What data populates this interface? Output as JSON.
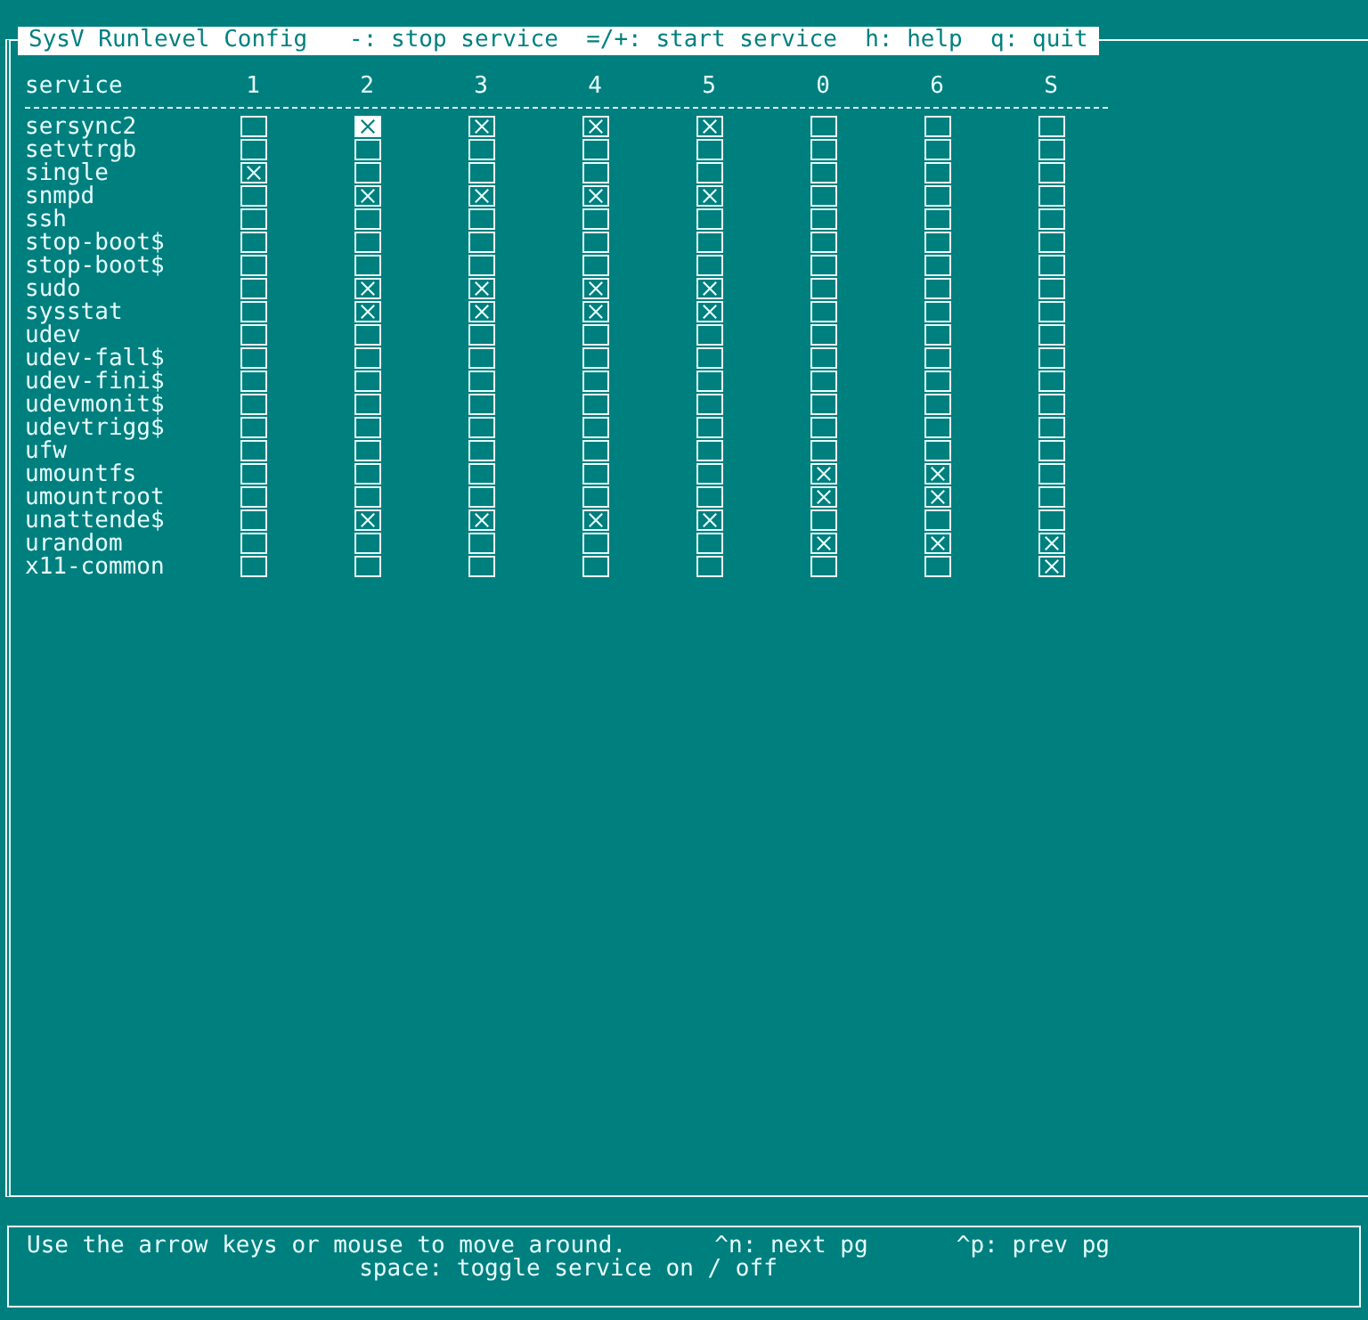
{
  "title": "SysV Runlevel Config   -: stop service  =/+: start service  h: help  q: quit",
  "columns": [
    "service",
    "1",
    "2",
    "3",
    "4",
    "5",
    "0",
    "6",
    "S"
  ],
  "rows": [
    {
      "service": "sersync2",
      "cells": [
        {
          "checked": false,
          "selected": false
        },
        {
          "checked": true,
          "selected": true
        },
        {
          "checked": true,
          "selected": false
        },
        {
          "checked": true,
          "selected": false
        },
        {
          "checked": true,
          "selected": false
        },
        {
          "checked": false,
          "selected": false
        },
        {
          "checked": false,
          "selected": false
        },
        {
          "checked": false,
          "selected": false
        }
      ]
    },
    {
      "service": "setvtrgb",
      "cells": [
        {
          "checked": false,
          "selected": false
        },
        {
          "checked": false,
          "selected": false
        },
        {
          "checked": false,
          "selected": false
        },
        {
          "checked": false,
          "selected": false
        },
        {
          "checked": false,
          "selected": false
        },
        {
          "checked": false,
          "selected": false
        },
        {
          "checked": false,
          "selected": false
        },
        {
          "checked": false,
          "selected": false
        }
      ]
    },
    {
      "service": "single",
      "cells": [
        {
          "checked": true,
          "selected": false
        },
        {
          "checked": false,
          "selected": false
        },
        {
          "checked": false,
          "selected": false
        },
        {
          "checked": false,
          "selected": false
        },
        {
          "checked": false,
          "selected": false
        },
        {
          "checked": false,
          "selected": false
        },
        {
          "checked": false,
          "selected": false
        },
        {
          "checked": false,
          "selected": false
        }
      ]
    },
    {
      "service": "snmpd",
      "cells": [
        {
          "checked": false,
          "selected": false
        },
        {
          "checked": true,
          "selected": false
        },
        {
          "checked": true,
          "selected": false
        },
        {
          "checked": true,
          "selected": false
        },
        {
          "checked": true,
          "selected": false
        },
        {
          "checked": false,
          "selected": false
        },
        {
          "checked": false,
          "selected": false
        },
        {
          "checked": false,
          "selected": false
        }
      ]
    },
    {
      "service": "ssh",
      "cells": [
        {
          "checked": false,
          "selected": false
        },
        {
          "checked": false,
          "selected": false
        },
        {
          "checked": false,
          "selected": false
        },
        {
          "checked": false,
          "selected": false
        },
        {
          "checked": false,
          "selected": false
        },
        {
          "checked": false,
          "selected": false
        },
        {
          "checked": false,
          "selected": false
        },
        {
          "checked": false,
          "selected": false
        }
      ]
    },
    {
      "service": "stop-boot$",
      "cells": [
        {
          "checked": false,
          "selected": false
        },
        {
          "checked": false,
          "selected": false
        },
        {
          "checked": false,
          "selected": false
        },
        {
          "checked": false,
          "selected": false
        },
        {
          "checked": false,
          "selected": false
        },
        {
          "checked": false,
          "selected": false
        },
        {
          "checked": false,
          "selected": false
        },
        {
          "checked": false,
          "selected": false
        }
      ]
    },
    {
      "service": "stop-boot$",
      "cells": [
        {
          "checked": false,
          "selected": false
        },
        {
          "checked": false,
          "selected": false
        },
        {
          "checked": false,
          "selected": false
        },
        {
          "checked": false,
          "selected": false
        },
        {
          "checked": false,
          "selected": false
        },
        {
          "checked": false,
          "selected": false
        },
        {
          "checked": false,
          "selected": false
        },
        {
          "checked": false,
          "selected": false
        }
      ]
    },
    {
      "service": "sudo",
      "cells": [
        {
          "checked": false,
          "selected": false
        },
        {
          "checked": true,
          "selected": false
        },
        {
          "checked": true,
          "selected": false
        },
        {
          "checked": true,
          "selected": false
        },
        {
          "checked": true,
          "selected": false
        },
        {
          "checked": false,
          "selected": false
        },
        {
          "checked": false,
          "selected": false
        },
        {
          "checked": false,
          "selected": false
        }
      ]
    },
    {
      "service": "sysstat",
      "cells": [
        {
          "checked": false,
          "selected": false
        },
        {
          "checked": true,
          "selected": false
        },
        {
          "checked": true,
          "selected": false
        },
        {
          "checked": true,
          "selected": false
        },
        {
          "checked": true,
          "selected": false
        },
        {
          "checked": false,
          "selected": false
        },
        {
          "checked": false,
          "selected": false
        },
        {
          "checked": false,
          "selected": false
        }
      ]
    },
    {
      "service": "udev",
      "cells": [
        {
          "checked": false,
          "selected": false
        },
        {
          "checked": false,
          "selected": false
        },
        {
          "checked": false,
          "selected": false
        },
        {
          "checked": false,
          "selected": false
        },
        {
          "checked": false,
          "selected": false
        },
        {
          "checked": false,
          "selected": false
        },
        {
          "checked": false,
          "selected": false
        },
        {
          "checked": false,
          "selected": false
        }
      ]
    },
    {
      "service": "udev-fall$",
      "cells": [
        {
          "checked": false,
          "selected": false
        },
        {
          "checked": false,
          "selected": false
        },
        {
          "checked": false,
          "selected": false
        },
        {
          "checked": false,
          "selected": false
        },
        {
          "checked": false,
          "selected": false
        },
        {
          "checked": false,
          "selected": false
        },
        {
          "checked": false,
          "selected": false
        },
        {
          "checked": false,
          "selected": false
        }
      ]
    },
    {
      "service": "udev-fini$",
      "cells": [
        {
          "checked": false,
          "selected": false
        },
        {
          "checked": false,
          "selected": false
        },
        {
          "checked": false,
          "selected": false
        },
        {
          "checked": false,
          "selected": false
        },
        {
          "checked": false,
          "selected": false
        },
        {
          "checked": false,
          "selected": false
        },
        {
          "checked": false,
          "selected": false
        },
        {
          "checked": false,
          "selected": false
        }
      ]
    },
    {
      "service": "udevmonit$",
      "cells": [
        {
          "checked": false,
          "selected": false
        },
        {
          "checked": false,
          "selected": false
        },
        {
          "checked": false,
          "selected": false
        },
        {
          "checked": false,
          "selected": false
        },
        {
          "checked": false,
          "selected": false
        },
        {
          "checked": false,
          "selected": false
        },
        {
          "checked": false,
          "selected": false
        },
        {
          "checked": false,
          "selected": false
        }
      ]
    },
    {
      "service": "udevtrigg$",
      "cells": [
        {
          "checked": false,
          "selected": false
        },
        {
          "checked": false,
          "selected": false
        },
        {
          "checked": false,
          "selected": false
        },
        {
          "checked": false,
          "selected": false
        },
        {
          "checked": false,
          "selected": false
        },
        {
          "checked": false,
          "selected": false
        },
        {
          "checked": false,
          "selected": false
        },
        {
          "checked": false,
          "selected": false
        }
      ]
    },
    {
      "service": "ufw",
      "cells": [
        {
          "checked": false,
          "selected": false
        },
        {
          "checked": false,
          "selected": false
        },
        {
          "checked": false,
          "selected": false
        },
        {
          "checked": false,
          "selected": false
        },
        {
          "checked": false,
          "selected": false
        },
        {
          "checked": false,
          "selected": false
        },
        {
          "checked": false,
          "selected": false
        },
        {
          "checked": false,
          "selected": false
        }
      ]
    },
    {
      "service": "umountfs",
      "cells": [
        {
          "checked": false,
          "selected": false
        },
        {
          "checked": false,
          "selected": false
        },
        {
          "checked": false,
          "selected": false
        },
        {
          "checked": false,
          "selected": false
        },
        {
          "checked": false,
          "selected": false
        },
        {
          "checked": true,
          "selected": false
        },
        {
          "checked": true,
          "selected": false
        },
        {
          "checked": false,
          "selected": false
        }
      ]
    },
    {
      "service": "umountroot",
      "cells": [
        {
          "checked": false,
          "selected": false
        },
        {
          "checked": false,
          "selected": false
        },
        {
          "checked": false,
          "selected": false
        },
        {
          "checked": false,
          "selected": false
        },
        {
          "checked": false,
          "selected": false
        },
        {
          "checked": true,
          "selected": false
        },
        {
          "checked": true,
          "selected": false
        },
        {
          "checked": false,
          "selected": false
        }
      ]
    },
    {
      "service": "unattende$",
      "cells": [
        {
          "checked": false,
          "selected": false
        },
        {
          "checked": true,
          "selected": false
        },
        {
          "checked": true,
          "selected": false
        },
        {
          "checked": true,
          "selected": false
        },
        {
          "checked": true,
          "selected": false
        },
        {
          "checked": false,
          "selected": false
        },
        {
          "checked": false,
          "selected": false
        },
        {
          "checked": false,
          "selected": false
        }
      ]
    },
    {
      "service": "urandom",
      "cells": [
        {
          "checked": false,
          "selected": false
        },
        {
          "checked": false,
          "selected": false
        },
        {
          "checked": false,
          "selected": false
        },
        {
          "checked": false,
          "selected": false
        },
        {
          "checked": false,
          "selected": false
        },
        {
          "checked": true,
          "selected": false
        },
        {
          "checked": true,
          "selected": false
        },
        {
          "checked": true,
          "selected": false
        }
      ]
    },
    {
      "service": "x11-common",
      "cells": [
        {
          "checked": false,
          "selected": false
        },
        {
          "checked": false,
          "selected": false
        },
        {
          "checked": false,
          "selected": false
        },
        {
          "checked": false,
          "selected": false
        },
        {
          "checked": false,
          "selected": false
        },
        {
          "checked": false,
          "selected": false
        },
        {
          "checked": false,
          "selected": false
        },
        {
          "checked": true,
          "selected": false
        }
      ]
    }
  ],
  "footer": {
    "lines": [
      [
        "Use the arrow keys or mouse to move around.",
        "^n: next pg",
        "^p: prev pg"
      ],
      [
        "space: toggle service on / off"
      ]
    ]
  }
}
